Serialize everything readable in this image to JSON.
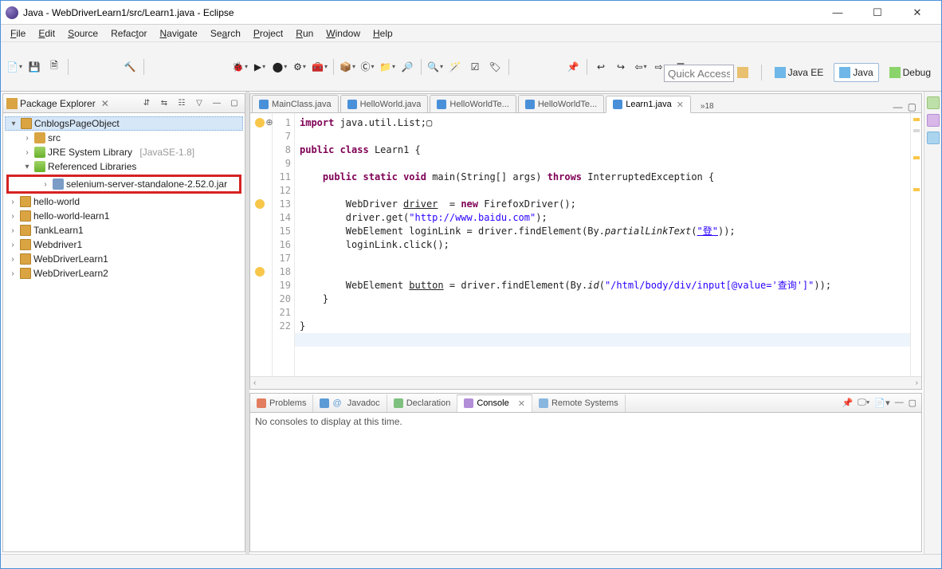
{
  "window": {
    "title": "Java - WebDriverLearn1/src/Learn1.java - Eclipse"
  },
  "menu": {
    "file": "File",
    "edit": "Edit",
    "source": "Source",
    "refactor": "Refactor",
    "navigate": "Navigate",
    "search": "Search",
    "project": "Project",
    "run": "Run",
    "window": "Window",
    "help": "Help"
  },
  "quick_access_placeholder": "Quick Access",
  "perspectives": {
    "javaee": "Java EE",
    "java": "Java",
    "debug": "Debug"
  },
  "pkg_explorer": {
    "title": "Package Explorer",
    "nodes": {
      "proj": "CnblogsPageObject",
      "src": "src",
      "jre": "JRE System Library",
      "jre_dec": "[JavaSE-1.8]",
      "reflib": "Referenced Libraries",
      "seljar": "selenium-server-standalone-2.52.0.jar",
      "hello_world": "hello-world",
      "hello_world_learn1": "hello-world-learn1",
      "tanklearn1": "TankLearn1",
      "webdriver1": "Webdriver1",
      "webdriverlearn1": "WebDriverLearn1",
      "webdriverlearn2": "WebDriverLearn2"
    }
  },
  "editor_tabs": {
    "t0": "MainClass.java",
    "t1": "HelloWorld.java",
    "t2": "HelloWorldTe...",
    "t3": "HelloWorldTe...",
    "t4": "Learn1.java",
    "more": "»18"
  },
  "code": {
    "l1a": "import",
    "l1b": " java.util.List;",
    "l3a": "public",
    "l3b": " class",
    "l3c": " Learn1 {",
    "l5a": "public",
    "l5b": " static",
    "l5c": " void",
    "l5d": " main(String[] args) ",
    "l5e": "throws",
    "l5f": " InterruptedException {",
    "l7a": "        WebDriver ",
    "l7b": "driver",
    "l7c": "  = ",
    "l7d": "new",
    "l7e": " FirefoxDriver();",
    "l8a": "        driver.get(",
    "l8b": "\"http://www.baidu.com\"",
    "l8c": ");",
    "l9a": "        WebElement loginLink = driver.findElement(By.",
    "l9b": "partialLinkText",
    "l9c": "(",
    "l9d": "\"登\"",
    "l9e": "));",
    "l10a": "        loginLink.click();",
    "l13a": "        WebElement ",
    "l13b": "button",
    "l13c": " = driver.findElement(By.",
    "l13d": "id",
    "l13e": "(",
    "l13f": "\"/html/body/div/input[@value='查询']\"",
    "l13g": "));",
    "l14": "    }",
    "l16": "}",
    "lnums": [
      "1",
      "7",
      "8",
      "9",
      "11",
      "12",
      "13",
      "14",
      "15",
      "16",
      "17",
      "18",
      "19",
      "20",
      "21",
      "22"
    ]
  },
  "bottom_tabs": {
    "problems": "Problems",
    "javadoc": "Javadoc",
    "declaration": "Declaration",
    "console": "Console",
    "remote": "Remote Systems"
  },
  "console_msg": "No consoles to display at this time."
}
